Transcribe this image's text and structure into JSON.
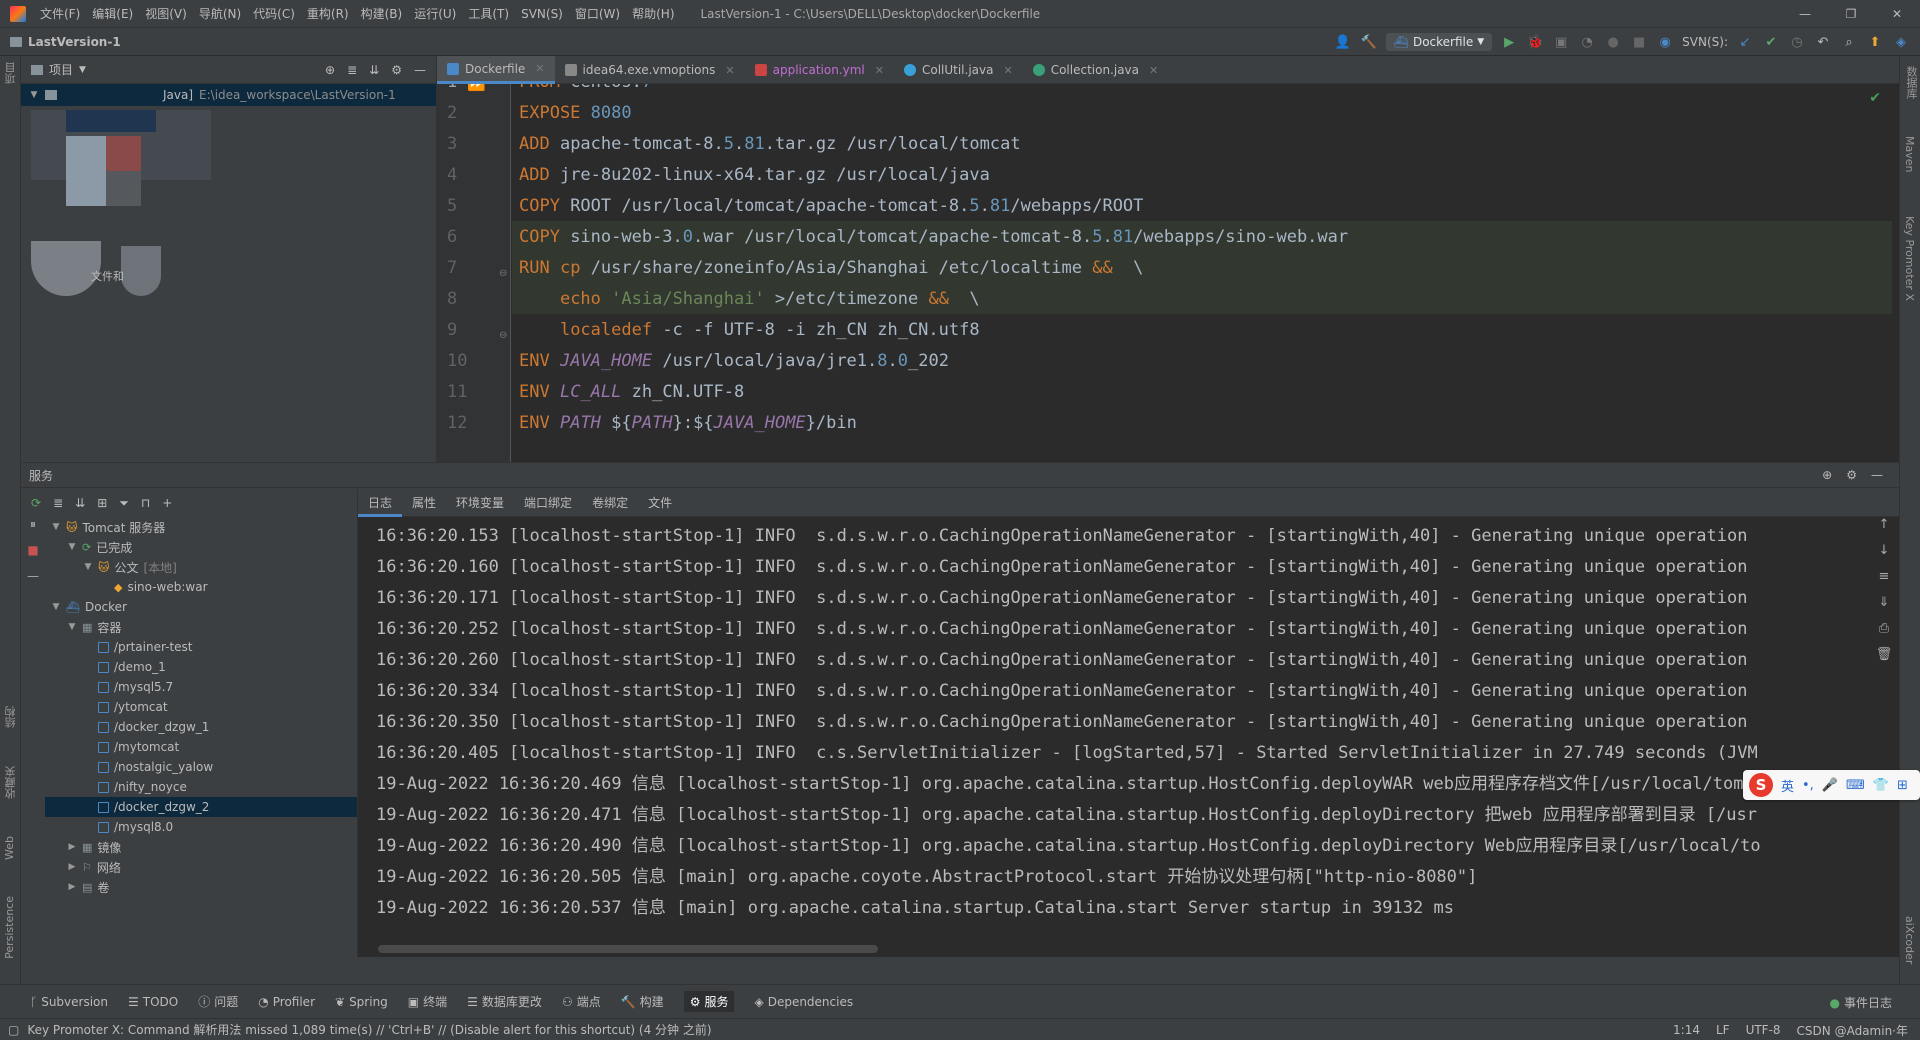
{
  "menubar": {
    "items": [
      "文件(F)",
      "编辑(E)",
      "视图(V)",
      "导航(N)",
      "代码(C)",
      "重构(R)",
      "构建(B)",
      "运行(U)",
      "工具(T)",
      "SVN(S)",
      "窗口(W)",
      "帮助(H)"
    ],
    "title": "LastVersion-1 - C:\\Users\\DELL\\Desktop\\docker\\Dockerfile"
  },
  "navbar": {
    "project": "LastVersion-1",
    "run_config": "Dockerfile",
    "svn_label": "SVN(S):"
  },
  "project_panel": {
    "title": "项目",
    "root_label": "Java]",
    "root_path": "E:\\idea_workspace\\LastVersion-1",
    "partial_text": "文件和"
  },
  "editor_tabs": [
    {
      "label": "Dockerfile",
      "color": "#4a88c7",
      "active": true
    },
    {
      "label": "idea64.exe.vmoptions",
      "color": "#888888",
      "active": false
    },
    {
      "label": "application.yml",
      "color": "#cc4444",
      "active": false
    },
    {
      "label": "CollUtil.java",
      "color": "#3aa0d8",
      "active": false
    },
    {
      "label": "Collection.java",
      "color": "#3aa07a",
      "active": false
    }
  ],
  "editor": {
    "line_numbers": [
      "1",
      "2",
      "3",
      "4",
      "5",
      "6",
      "7",
      "8",
      "9",
      "10",
      "11",
      "12"
    ]
  },
  "services": {
    "title": "服务",
    "tree": [
      {
        "label": "Tomcat 服务器",
        "depth": 0,
        "arrow": "▼",
        "icon": "tomcat-icon"
      },
      {
        "label": "已完成",
        "depth": 1,
        "arrow": "▼",
        "icon": "finished-icon"
      },
      {
        "label": "公文",
        "extra": "[本地]",
        "depth": 2,
        "arrow": "▼",
        "icon": "tomcat-icon"
      },
      {
        "label": "sino-web:war",
        "depth": 3,
        "arrow": "",
        "icon": "artifact-icon"
      },
      {
        "label": "Docker",
        "depth": 0,
        "arrow": "▼",
        "icon": "docker-icon"
      },
      {
        "label": "容器",
        "depth": 1,
        "arrow": "▼",
        "icon": "containers-icon"
      },
      {
        "label": "/prtainer-test",
        "depth": 2,
        "arrow": "",
        "icon": "container-icon"
      },
      {
        "label": "/demo_1",
        "depth": 2,
        "arrow": "",
        "icon": "container-icon"
      },
      {
        "label": "/mysql5.7",
        "depth": 2,
        "arrow": "",
        "icon": "container-icon"
      },
      {
        "label": "/ytomcat",
        "depth": 2,
        "arrow": "",
        "icon": "container-icon"
      },
      {
        "label": "/docker_dzgw_1",
        "depth": 2,
        "arrow": "",
        "icon": "container-icon"
      },
      {
        "label": "/mytomcat",
        "depth": 2,
        "arrow": "",
        "icon": "container-icon"
      },
      {
        "label": "/nostalgic_yalow",
        "depth": 2,
        "arrow": "",
        "icon": "container-icon"
      },
      {
        "label": "/nifty_noyce",
        "depth": 2,
        "arrow": "",
        "icon": "container-icon"
      },
      {
        "label": "/docker_dzgw_2",
        "depth": 2,
        "arrow": "",
        "icon": "container-icon",
        "selected": true
      },
      {
        "label": "/mysql8.0",
        "depth": 2,
        "arrow": "",
        "icon": "container-icon"
      },
      {
        "label": "镜像",
        "depth": 1,
        "arrow": "▶",
        "icon": "images-icon"
      },
      {
        "label": "网络",
        "depth": 1,
        "arrow": "▶",
        "icon": "network-icon"
      },
      {
        "label": "卷",
        "depth": 1,
        "arrow": "▶",
        "icon": "volumes-icon"
      }
    ],
    "log_tabs": [
      "日志",
      "属性",
      "环境变量",
      "端口绑定",
      "卷绑定",
      "文件"
    ],
    "log_lines": [
      "16:36:20.153 [localhost-startStop-1] INFO  s.d.s.w.r.o.CachingOperationNameGenerator - [startingWith,40] - Generating unique operation",
      "16:36:20.160 [localhost-startStop-1] INFO  s.d.s.w.r.o.CachingOperationNameGenerator - [startingWith,40] - Generating unique operation",
      "16:36:20.171 [localhost-startStop-1] INFO  s.d.s.w.r.o.CachingOperationNameGenerator - [startingWith,40] - Generating unique operation",
      "16:36:20.252 [localhost-startStop-1] INFO  s.d.s.w.r.o.CachingOperationNameGenerator - [startingWith,40] - Generating unique operation",
      "16:36:20.260 [localhost-startStop-1] INFO  s.d.s.w.r.o.CachingOperationNameGenerator - [startingWith,40] - Generating unique operation",
      "16:36:20.334 [localhost-startStop-1] INFO  s.d.s.w.r.o.CachingOperationNameGenerator - [startingWith,40] - Generating unique operation",
      "16:36:20.350 [localhost-startStop-1] INFO  s.d.s.w.r.o.CachingOperationNameGenerator - [startingWith,40] - Generating unique operation",
      "16:36:20.405 [localhost-startStop-1] INFO  c.s.ServletInitializer - [logStarted,57] - Started ServletInitializer in 27.749 seconds (JVM",
      "19-Aug-2022 16:36:20.469 信息 [localhost-startStop-1] org.apache.catalina.startup.HostConfig.deployWAR web应用程序存档文件[/usr/local/tomc",
      "19-Aug-2022 16:36:20.471 信息 [localhost-startStop-1] org.apache.catalina.startup.HostConfig.deployDirectory 把web 应用程序部署到目录 [/usr",
      "19-Aug-2022 16:36:20.490 信息 [localhost-startStop-1] org.apache.catalina.startup.HostConfig.deployDirectory Web应用程序目录[/usr/local/to",
      "19-Aug-2022 16:36:20.505 信息 [main] org.apache.coyote.AbstractProtocol.start 开始协议处理句柄[\"http-nio-8080\"]",
      "19-Aug-2022 16:36:20.537 信息 [main] org.apache.catalina.startup.Catalina.start Server startup in 39132 ms"
    ]
  },
  "ime": {
    "lang": "英"
  },
  "bottom_tools": [
    {
      "label": "Subversion",
      "icon": "subversion-icon"
    },
    {
      "label": "TODO",
      "icon": "todo-icon"
    },
    {
      "label": "问题",
      "icon": "problems-icon"
    },
    {
      "label": "Profiler",
      "icon": "profiler-icon"
    },
    {
      "label": "Spring",
      "icon": "spring-icon"
    },
    {
      "label": "终端",
      "icon": "terminal-icon"
    },
    {
      "label": "数据库更改",
      "icon": "database-icon"
    },
    {
      "label": "端点",
      "icon": "endpoints-icon"
    },
    {
      "label": "构建",
      "icon": "build-icon"
    },
    {
      "label": "服务",
      "icon": "services-icon",
      "active": true
    },
    {
      "label": "Dependencies",
      "icon": "dependencies-icon"
    }
  ],
  "event_log": "事件日志",
  "statusbar": {
    "message": "Key Promoter X: Command 解析用法 missed 1,089 time(s) // 'Ctrl+B' // (Disable alert for this shortcut) (4 分钟 之前)",
    "position": "1:14",
    "line_sep": "LF",
    "encoding": "UTF-8",
    "extra": "CSDN @Adamin·年"
  },
  "stripes": {
    "left_top": "项目",
    "left_structure": "结构",
    "left_favorites": "收藏夹",
    "left_web": "Web",
    "left_persistence": "Persistence",
    "right_database": "数据库",
    "right_maven": "Maven",
    "right_key_promoter": "Key Promoter X",
    "right_aicoder": "aiXcoder"
  }
}
